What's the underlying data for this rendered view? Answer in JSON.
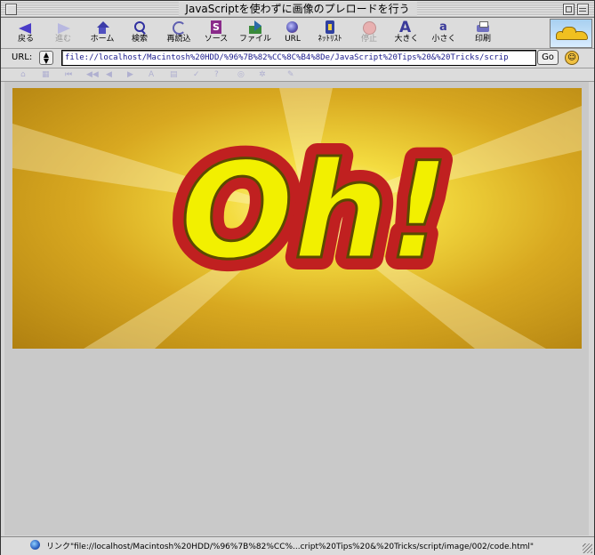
{
  "window": {
    "title": "JavaScriptを使わずに画像のプレロードを行う"
  },
  "toolbar": {
    "buttons": [
      {
        "label": "戻る",
        "icon": "back-arrow-icon",
        "enabled": true
      },
      {
        "label": "進む",
        "icon": "forward-arrow-icon",
        "enabled": false
      },
      {
        "label": "ホーム",
        "icon": "home-icon",
        "enabled": true
      },
      {
        "label": "検索",
        "icon": "search-icon",
        "enabled": true
      },
      {
        "label": "再読込",
        "icon": "reload-icon",
        "enabled": true
      },
      {
        "label": "ソース",
        "icon": "source-icon",
        "enabled": true
      },
      {
        "label": "ファイル",
        "icon": "file-icon",
        "enabled": true
      },
      {
        "label": "URL",
        "icon": "url-globe-icon",
        "enabled": true
      },
      {
        "label": "ﾈｯﾄﾘｽﾄ",
        "icon": "netlist-icon",
        "enabled": true
      },
      {
        "label": "停止",
        "icon": "stop-icon",
        "enabled": false
      },
      {
        "label": "大きく",
        "icon": "bigger-text-icon",
        "enabled": true
      },
      {
        "label": "小さく",
        "icon": "smaller-text-icon",
        "enabled": true
      },
      {
        "label": "印刷",
        "icon": "print-icon",
        "enabled": true
      }
    ]
  },
  "urlbar": {
    "label": "URL:",
    "value": "file://localhost/Macintosh%20HDD/%96%7B%82%CC%8C%B4%8De/JavaScript%20Tips%20&%20Tricks/scrip",
    "go_label": "Go",
    "smiley": "☺"
  },
  "content": {
    "banner_text": "Oh!",
    "colors": {
      "text_fill": "#f2f000",
      "text_outline": "#c02020",
      "background": "#e8c030"
    }
  },
  "statusbar": {
    "text": "リンク\"file://localhost/Macintosh%20HDD/%96%7B%82%CC%...cript%20Tips%20&%20Tricks/script/image/002/code.html\""
  }
}
